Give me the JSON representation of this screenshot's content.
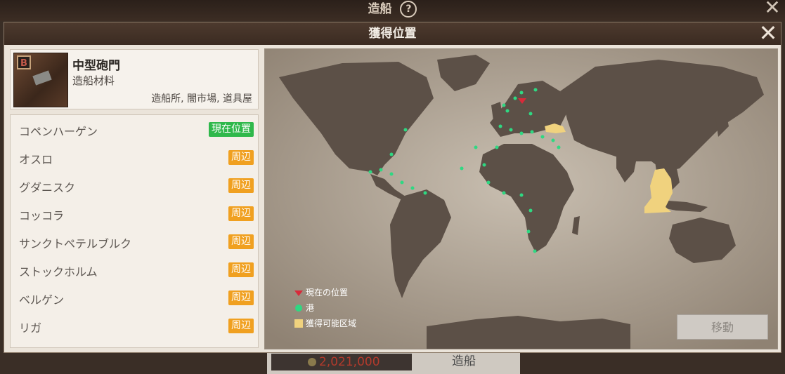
{
  "background": {
    "title": "造船",
    "help_symbol": "?",
    "close_symbol": "✕",
    "price": "2,021,000",
    "build_label": "造船"
  },
  "modal": {
    "title": "獲得位置",
    "close_symbol": "✕"
  },
  "item": {
    "grade": "B",
    "name": "中型砲門",
    "type": "造船材料",
    "sources": "造船所, 闇市場, 道具屋"
  },
  "locations": [
    {
      "name": "コペンハーゲン",
      "badge": "現在位置",
      "status": "current"
    },
    {
      "name": "オスロ",
      "badge": "周辺",
      "status": "near"
    },
    {
      "name": "グダニスク",
      "badge": "周辺",
      "status": "near"
    },
    {
      "name": "コッコラ",
      "badge": "周辺",
      "status": "near"
    },
    {
      "name": "サンクトペテルブルク",
      "badge": "周辺",
      "status": "near"
    },
    {
      "name": "ストックホルム",
      "badge": "周辺",
      "status": "near"
    },
    {
      "name": "ベルゲン",
      "badge": "周辺",
      "status": "near"
    },
    {
      "name": "リガ",
      "badge": "周辺",
      "status": "near"
    }
  ],
  "legend": {
    "current": "現在の位置",
    "port": "港",
    "area": "獲得可能区域"
  },
  "move_button": "移動",
  "colors": {
    "current_badge": "#2fb84b",
    "near_badge": "#f0a020",
    "port_dot": "#2fd882",
    "current_marker": "#d82a3a",
    "area": "#f0d27e"
  }
}
